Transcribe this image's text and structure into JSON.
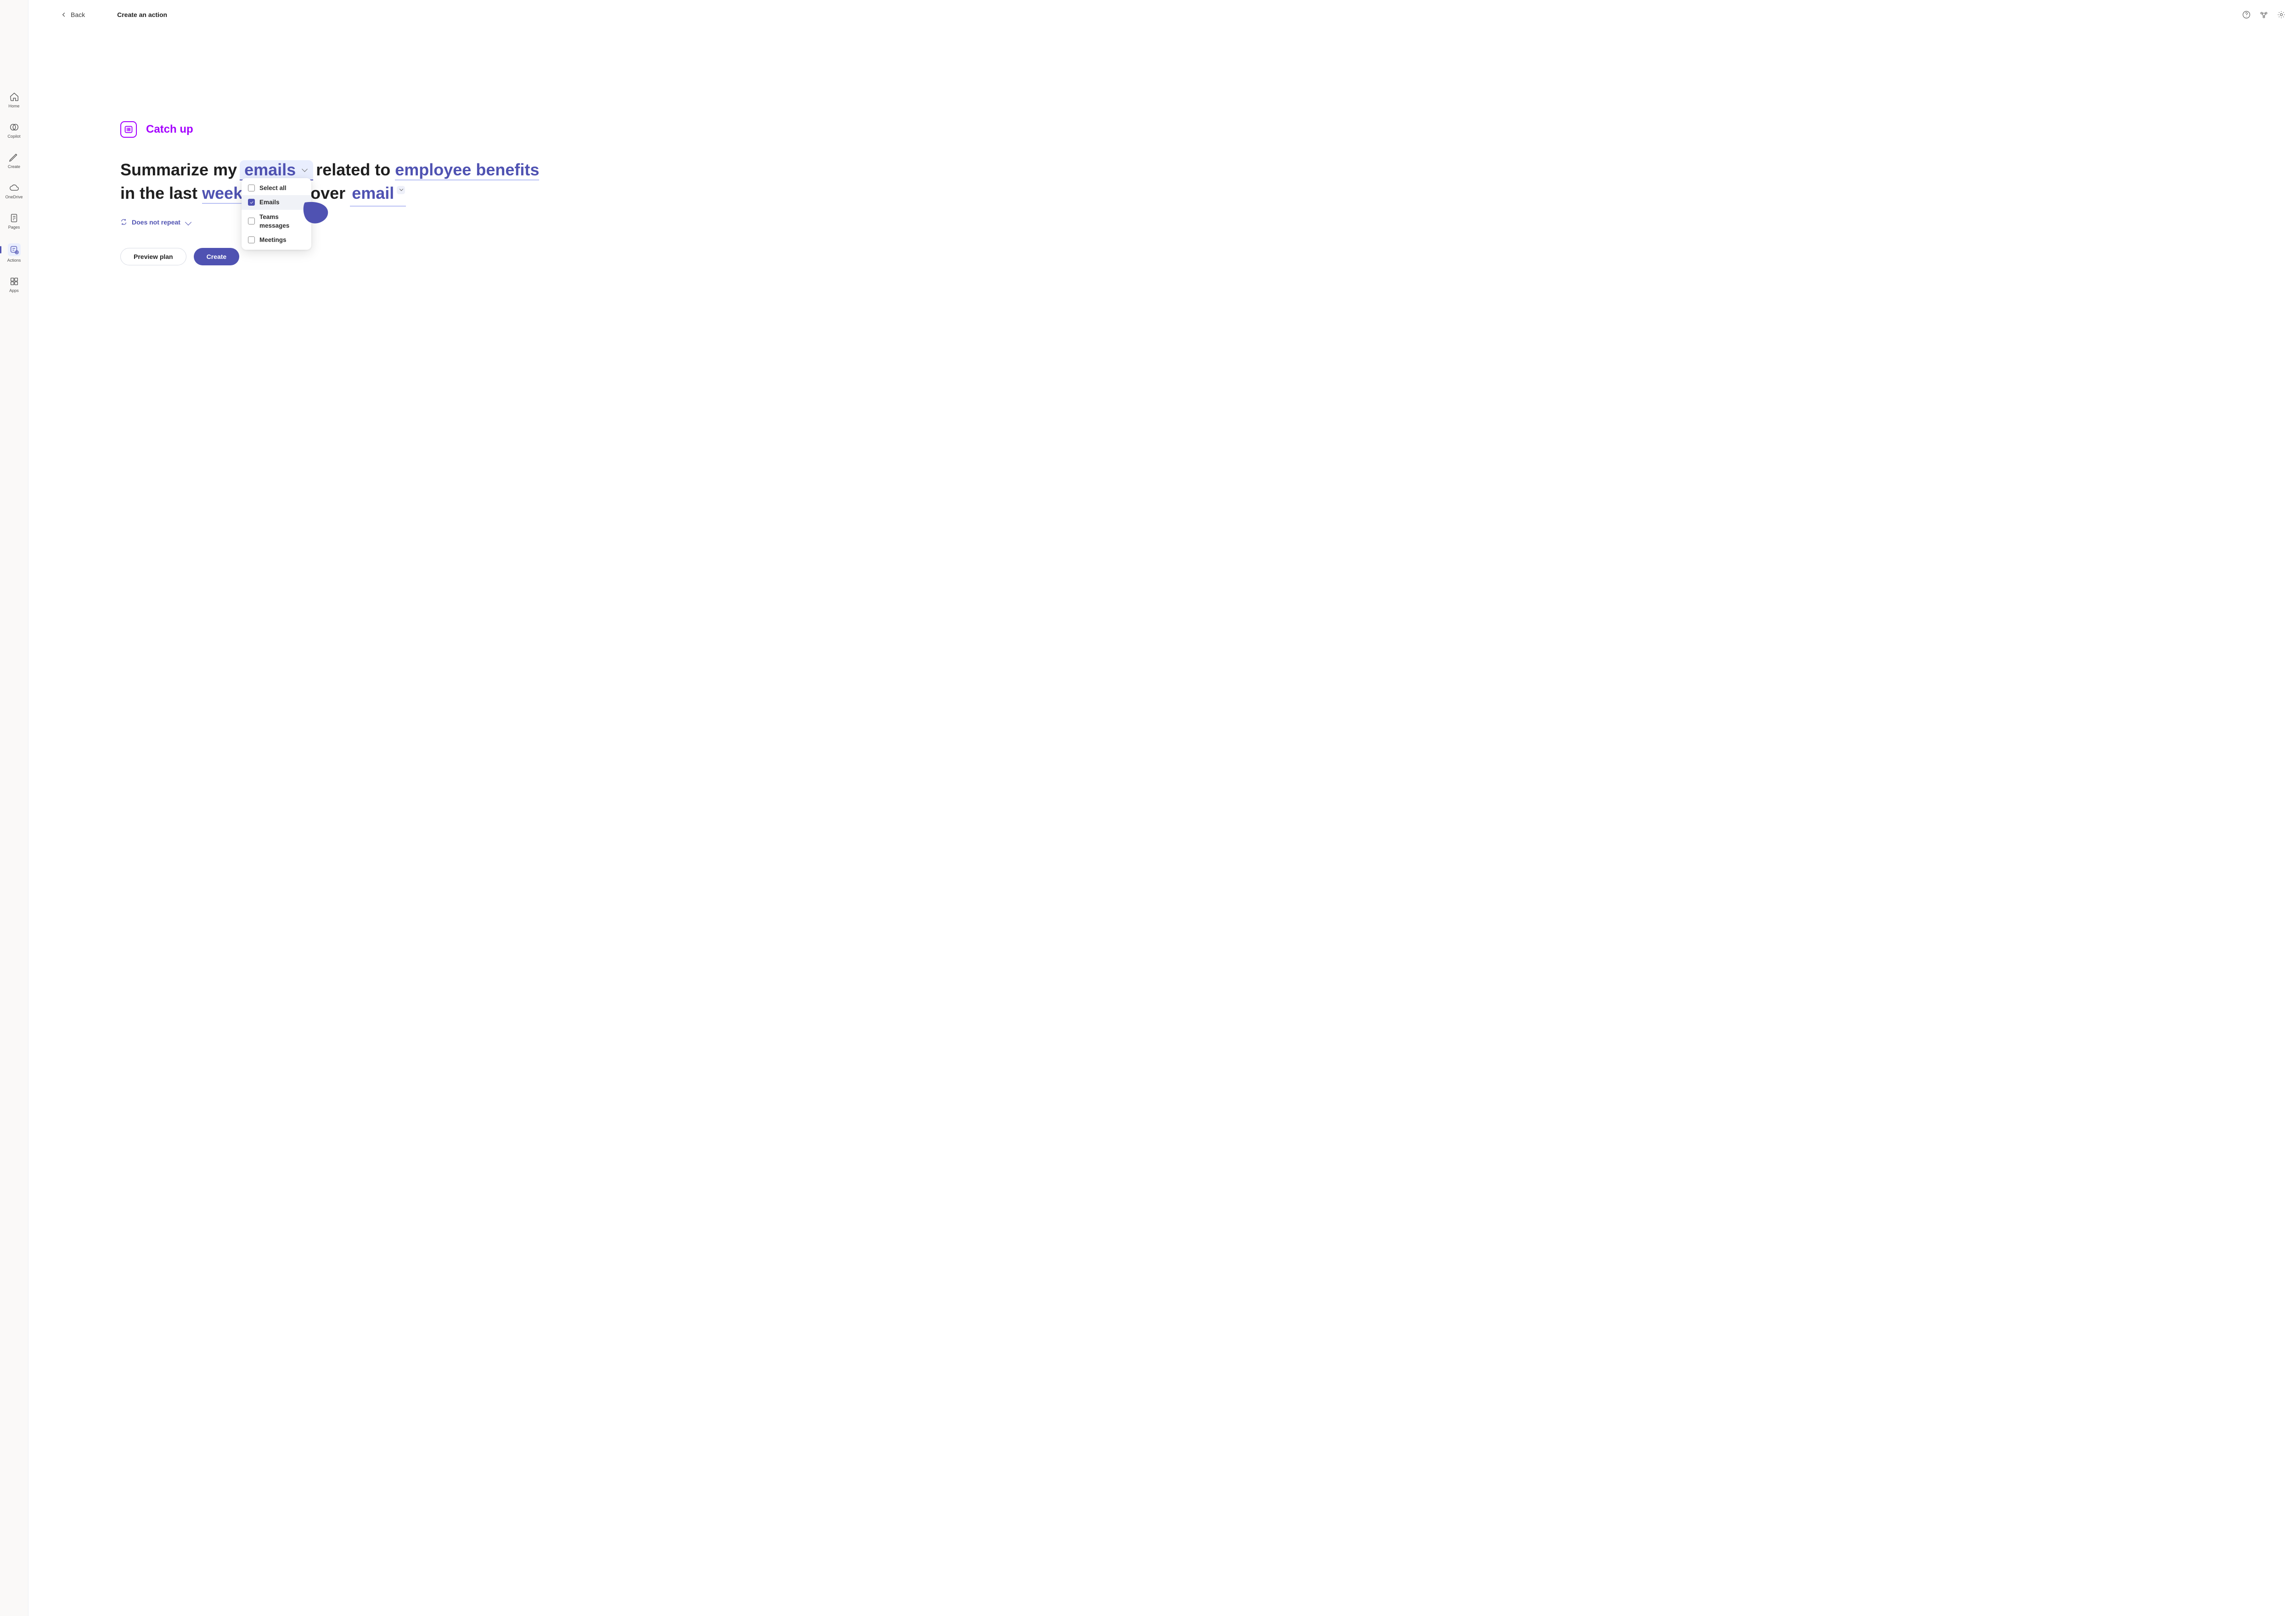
{
  "header": {
    "back_label": "Back",
    "title": "Create an action"
  },
  "rail": {
    "items": [
      {
        "key": "home",
        "label": "Home"
      },
      {
        "key": "copilot",
        "label": "Copilot"
      },
      {
        "key": "create",
        "label": "Create"
      },
      {
        "key": "onedrive",
        "label": "OneDrive"
      },
      {
        "key": "pages",
        "label": "Pages"
      },
      {
        "key": "actions",
        "label": "Actions"
      },
      {
        "key": "apps",
        "label": "Apps"
      }
    ]
  },
  "badge": {
    "title": "Catch up"
  },
  "sentence": {
    "part1": "Summarize my ",
    "token_source": "emails",
    "part2": " related to ",
    "token_topic": "employee benefits",
    "part3": " in the last ",
    "token_range": "week",
    "part4": "otify me over ",
    "token_channel": "email"
  },
  "repeat": {
    "label": "Does not repeat"
  },
  "dropdown": {
    "options": [
      {
        "label": "Select all",
        "checked": false
      },
      {
        "label": "Emails",
        "checked": true
      },
      {
        "label": "Teams messages",
        "checked": false
      },
      {
        "label": "Meetings",
        "checked": false
      }
    ]
  },
  "buttons": {
    "preview": "Preview plan",
    "create": "Create"
  }
}
